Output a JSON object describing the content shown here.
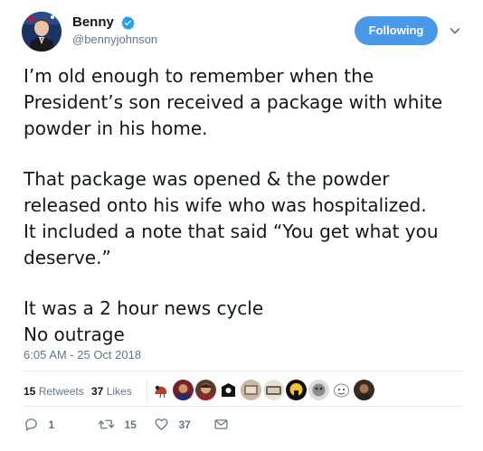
{
  "user": {
    "display_name": "Benny",
    "handle": "@bennyjohnson",
    "verified": true,
    "avatar_icon": "profile-avatar"
  },
  "follow_button": {
    "label": "Following",
    "color": "#4a99e9"
  },
  "tweet": {
    "paragraphs": [
      "I’m old enough to remember when the President’s son received a package with white powder in his home.",
      "That package was opened & the powder released onto his wife who was hospitalized. It included a note that said “You get what you deserve.”",
      "It was a 2 hour news cycle\nNo outrage"
    ],
    "lines": [
      "I’m old enough to remember when the",
      "President’s son received a package with white",
      "powder in his home.",
      "That package was opened & the powder",
      "released onto his wife who was hospitalized.",
      "It included a note that said “You get what you",
      "deserve.”",
      "It was a 2 hour news cycle",
      "No outrage"
    ],
    "timestamp": "6:05 AM - 25 Oct 2018"
  },
  "stats": {
    "retweets_count": "15",
    "retweets_label": "Retweets",
    "likes_count": "37",
    "likes_label": "Likes"
  },
  "actions": {
    "reply_count": "1",
    "retweet_count": "15",
    "like_count": "37"
  },
  "colors": {
    "text": "#14171a",
    "secondary": "#657786",
    "divider": "#e6ecf0",
    "verified": "#1da1f2"
  }
}
